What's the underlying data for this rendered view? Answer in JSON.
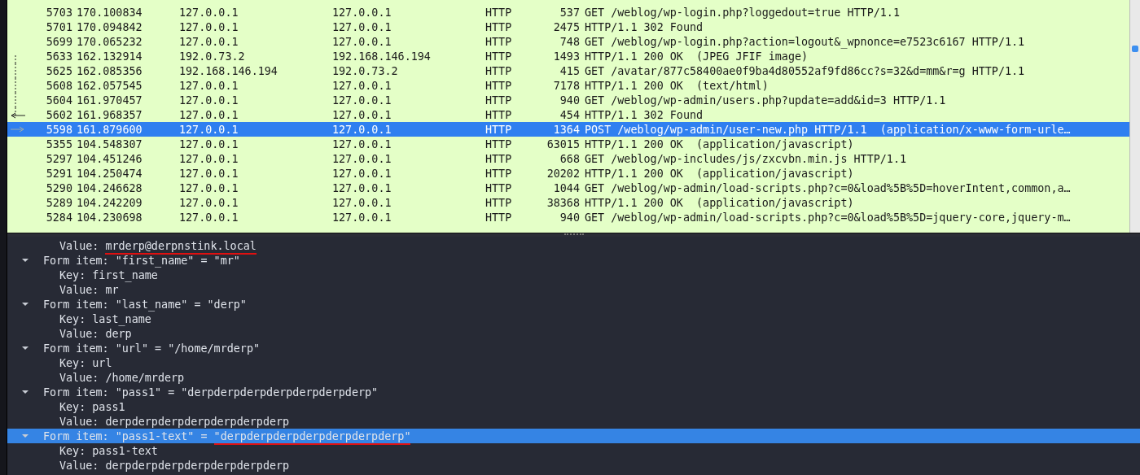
{
  "packet_list": {
    "rows": [
      {
        "no": "5703",
        "time": "170.100834",
        "source": "127.0.0.1",
        "destination": "127.0.0.1",
        "protocol": "HTTP",
        "length": "537",
        "info": "GET /weblog/wp-login.php?loggedout=true HTTP/1.1",
        "selected": false
      },
      {
        "no": "5701",
        "time": "170.094842",
        "source": "127.0.0.1",
        "destination": "127.0.0.1",
        "protocol": "HTTP",
        "length": "2475",
        "info": "HTTP/1.1 302 Found",
        "selected": false
      },
      {
        "no": "5699",
        "time": "170.065232",
        "source": "127.0.0.1",
        "destination": "127.0.0.1",
        "protocol": "HTTP",
        "length": "748",
        "info": "GET /weblog/wp-login.php?action=logout&_wpnonce=e7523c6167 HTTP/1.1",
        "selected": false
      },
      {
        "no": "5633",
        "time": "162.132914",
        "source": "192.0.73.2",
        "destination": "192.168.146.194",
        "protocol": "HTTP",
        "length": "1493",
        "info": "HTTP/1.1 200 OK  (JPEG JFIF image)",
        "selected": false,
        "kind": "start"
      },
      {
        "no": "5625",
        "time": "162.085356",
        "source": "192.168.146.194",
        "destination": "192.0.73.2",
        "protocol": "HTTP",
        "length": "415",
        "info": "GET /avatar/877c58400ae0f9ba4d80552af9fd86cc?s=32&d=mm&r=g HTTP/1.1",
        "selected": false,
        "kind": "line"
      },
      {
        "no": "5608",
        "time": "162.057545",
        "source": "127.0.0.1",
        "destination": "127.0.0.1",
        "protocol": "HTTP",
        "length": "7178",
        "info": "HTTP/1.1 200 OK  (text/html)",
        "selected": false,
        "kind": "line"
      },
      {
        "no": "5604",
        "time": "161.970457",
        "source": "127.0.0.1",
        "destination": "127.0.0.1",
        "protocol": "HTTP",
        "length": "940",
        "info": "GET /weblog/wp-admin/users.php?update=add&id=3 HTTP/1.1",
        "selected": false,
        "kind": "line"
      },
      {
        "no": "5602",
        "time": "161.968357",
        "source": "127.0.0.1",
        "destination": "127.0.0.1",
        "protocol": "HTTP",
        "length": "454",
        "info": "HTTP/1.1 302 Found",
        "selected": false,
        "kind": "response"
      },
      {
        "no": "5598",
        "time": "161.879600",
        "source": "127.0.0.1",
        "destination": "127.0.0.1",
        "protocol": "HTTP",
        "length": "1364",
        "info": "POST /weblog/wp-admin/user-new.php HTTP/1.1  (application/x-www-form-urle…",
        "selected": true,
        "kind": "request"
      },
      {
        "no": "5355",
        "time": "104.548307",
        "source": "127.0.0.1",
        "destination": "127.0.0.1",
        "protocol": "HTTP",
        "length": "63015",
        "info": "HTTP/1.1 200 OK  (application/javascript)",
        "selected": false
      },
      {
        "no": "5297",
        "time": "104.451246",
        "source": "127.0.0.1",
        "destination": "127.0.0.1",
        "protocol": "HTTP",
        "length": "668",
        "info": "GET /weblog/wp-includes/js/zxcvbn.min.js HTTP/1.1",
        "selected": false
      },
      {
        "no": "5291",
        "time": "104.250474",
        "source": "127.0.0.1",
        "destination": "127.0.0.1",
        "protocol": "HTTP",
        "length": "20202",
        "info": "HTTP/1.1 200 OK  (application/javascript)",
        "selected": false
      },
      {
        "no": "5290",
        "time": "104.246628",
        "source": "127.0.0.1",
        "destination": "127.0.0.1",
        "protocol": "HTTP",
        "length": "1044",
        "info": "GET /weblog/wp-admin/load-scripts.php?c=0&load%5B%5D=hoverIntent,common,a…",
        "selected": false
      },
      {
        "no": "5289",
        "time": "104.242209",
        "source": "127.0.0.1",
        "destination": "127.0.0.1",
        "protocol": "HTTP",
        "length": "38368",
        "info": "HTTP/1.1 200 OK  (application/javascript)",
        "selected": false
      },
      {
        "no": "5284",
        "time": "104.230698",
        "source": "127.0.0.1",
        "destination": "127.0.0.1",
        "protocol": "HTTP",
        "length": "940",
        "info": "GET /weblog/wp-admin/load-scripts.php?c=0&load%5B%5D=jquery-core,jquery-m…",
        "selected": false
      }
    ]
  },
  "packet_details": {
    "leading": [
      {
        "prefix": "Value: ",
        "underlined": "mrderp@derpnstink.local"
      }
    ],
    "items": [
      {
        "text": "Form item: \"first_name\" = \"mr\"",
        "expanded": true,
        "selected": false,
        "children": [
          {
            "text": "Key: first_name"
          },
          {
            "text": "Value: mr"
          }
        ]
      },
      {
        "text": "Form item: \"last_name\" = \"derp\"",
        "expanded": true,
        "selected": false,
        "children": [
          {
            "text": "Key: last_name"
          },
          {
            "text": "Value: derp"
          }
        ]
      },
      {
        "text": "Form item: \"url\" = \"/home/mrderp\"",
        "expanded": true,
        "selected": false,
        "children": [
          {
            "text": "Key: url"
          },
          {
            "text": "Value: /home/mrderp"
          }
        ]
      },
      {
        "text": "Form item: \"pass1\" = \"derpderpderpderpderpderpderp\"",
        "expanded": true,
        "selected": false,
        "children": [
          {
            "text": "Key: pass1"
          },
          {
            "text": "Value: derpderpderpderpderpderpderp"
          }
        ]
      },
      {
        "text": "Form item: \"pass1-text\" = ",
        "underlined": "\"derpderpderpderpderpderpderp\"",
        "expanded": true,
        "selected": true,
        "children": [
          {
            "text": "Key: pass1-text"
          },
          {
            "text": "Value: derpderpderpderpderpderpderp"
          }
        ]
      }
    ]
  }
}
